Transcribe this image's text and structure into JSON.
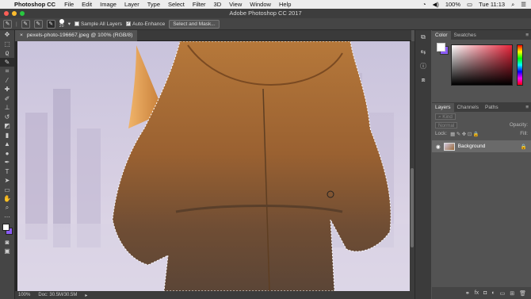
{
  "menubar": {
    "apple": "",
    "app_name": "Photoshop CC",
    "items": [
      "File",
      "Edit",
      "Image",
      "Layer",
      "Type",
      "Select",
      "Filter",
      "3D",
      "View",
      "Window",
      "Help"
    ],
    "battery": "100%",
    "clock": "Tue 11:13"
  },
  "window_title": "Adobe Photoshop CC 2017",
  "options": {
    "brush_size": "20",
    "sample_all_layers": "Sample All Layers",
    "auto_enhance": "Auto-Enhance",
    "select_mask": "Select and Mask..."
  },
  "document": {
    "tab_label": "pexels-photo-196667.jpeg @ 100% (RGB/8)",
    "close": "×"
  },
  "status": {
    "zoom": "100%",
    "doc_size": "Doc: 30.5M/30.5M"
  },
  "color_panel": {
    "tabs": [
      "Color",
      "Swatches"
    ],
    "fg_color": "#ffffff",
    "bg_color": "#8b5cf6"
  },
  "layers_panel": {
    "tabs": [
      "Layers",
      "Channels",
      "Paths"
    ],
    "filter_label": "Kind",
    "blend_mode": "Normal",
    "opacity_label": "Opacity:",
    "lock_label": "Lock:",
    "fill_label": "Fill:",
    "layer_name": "Background"
  }
}
